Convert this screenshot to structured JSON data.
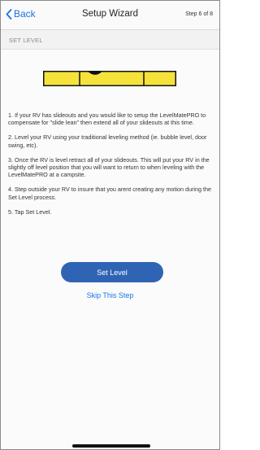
{
  "navbar": {
    "back_label": "Back",
    "title": "Setup Wizard",
    "step": "Step 6 of 8"
  },
  "section": {
    "header": "SET LEVEL"
  },
  "level_indicator": {
    "bar_color": "#f5e23a",
    "outline_color": "#111111"
  },
  "instructions": [
    "1. If your RV has slideouts and you would like to setup the LevelMatePRO to compensate for \"slide lean\" then extend all of your slideouts at this time.",
    "2. Level your RV using your traditional leveling method (ie. bubble level, door swing, etc).",
    "3. Once the RV is level retract all of your slideouts. This will put your RV in the slightly off level position that you will want to return to when leveling with the LevelMatePRO at a campsite.",
    "4. Step outside your RV to insure that you arent creating any motion during the Set Level process.",
    "5. Tap Set Level."
  ],
  "actions": {
    "set_level_label": "Set Level",
    "skip_label": "Skip This Step"
  },
  "colors": {
    "accent": "#1a73e8",
    "button": "#2f64b5"
  }
}
